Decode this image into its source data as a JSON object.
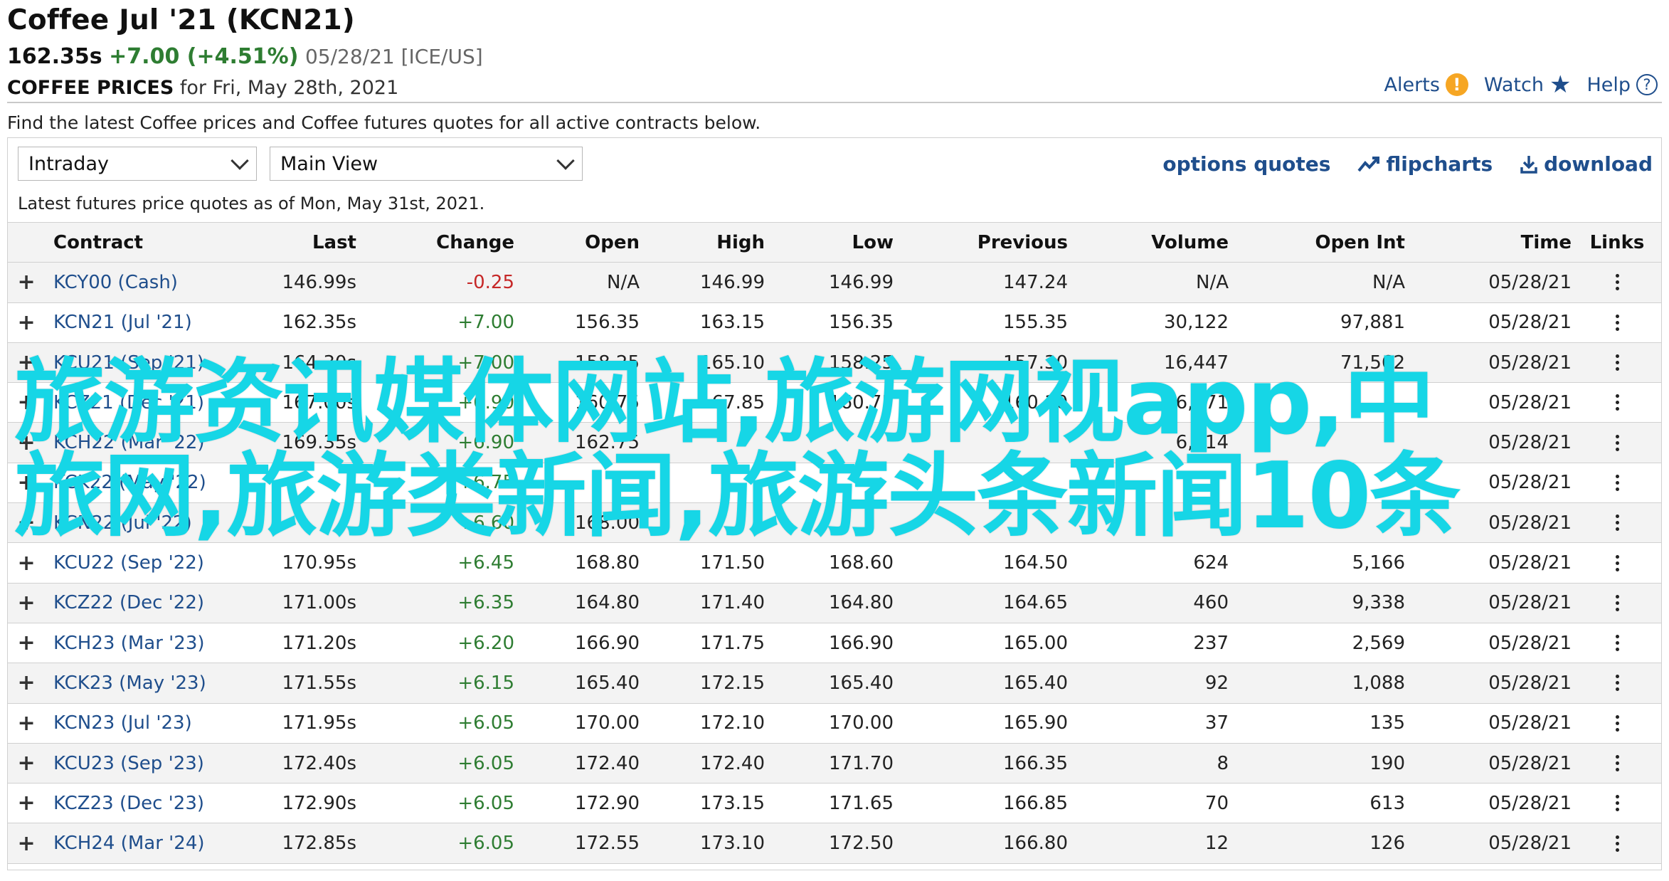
{
  "header": {
    "title": "Coffee Jul '21 (KCN21)",
    "last": "162.35s",
    "change": "+7.00 (+4.51%)",
    "date_exchange": "05/28/21 [ICE/US]",
    "section": "COFFEE PRICES",
    "for_date": "for Fri, May 28th, 2021"
  },
  "top_actions": {
    "alerts": "Alerts",
    "watch": "Watch",
    "help": "Help"
  },
  "description": "Find the latest Coffee prices and Coffee futures quotes for all active contracts below.",
  "controls": {
    "period_select": "Intraday",
    "view_select": "Main View",
    "options_quotes": "options quotes",
    "flipcharts": "flipcharts",
    "download": "download"
  },
  "as_of": "Latest futures price quotes as of Mon, May 31st, 2021.",
  "table": {
    "headers": {
      "contract": "Contract",
      "last": "Last",
      "change": "Change",
      "open": "Open",
      "high": "High",
      "low": "Low",
      "previous": "Previous",
      "volume": "Volume",
      "open_int": "Open Int",
      "time": "Time",
      "links": "Links"
    },
    "rows": [
      {
        "contract": "KCY00 (Cash)",
        "last": "146.99s",
        "change": "-0.25",
        "dir": "neg",
        "open": "N/A",
        "high": "146.99",
        "low": "146.99",
        "previous": "147.24",
        "volume": "N/A",
        "open_int": "N/A",
        "time": "05/28/21"
      },
      {
        "contract": "KCN21 (Jul '21)",
        "last": "162.35s",
        "change": "+7.00",
        "dir": "pos",
        "open": "156.35",
        "high": "163.15",
        "low": "156.35",
        "previous": "155.35",
        "volume": "30,122",
        "open_int": "97,881",
        "time": "05/28/21"
      },
      {
        "contract": "KCU21 (Sep '21)",
        "last": "164.30s",
        "change": "+7.00",
        "dir": "pos",
        "open": "158.25",
        "high": "165.10",
        "low": "158.25",
        "previous": "157.30",
        "volume": "16,447",
        "open_int": "71,562",
        "time": "05/28/21"
      },
      {
        "contract": "KCZ21 (Dec '21)",
        "last": "167.00s",
        "change": "+6.90",
        "dir": "pos",
        "open": "160.75",
        "high": "167.85",
        "low": "160.75",
        "previous": "160.10",
        "volume": "6,371",
        "open_int": "",
        "time": "05/28/21"
      },
      {
        "contract": "KCH22 (Mar '22)",
        "last": "169.35s",
        "change": "+6.90",
        "dir": "pos",
        "open": "162.75",
        "high": "",
        "low": "",
        "previous": "",
        "volume": "6,414",
        "open_int": "",
        "time": "05/28/21"
      },
      {
        "contract": "KCK22 (May '22)",
        "last": "",
        "change": "+6.75",
        "dir": "pos",
        "open": "",
        "high": "",
        "low": "",
        "previous": "",
        "volume": "",
        "open_int": "",
        "time": "05/28/21"
      },
      {
        "contract": "KCN22 (Jul '22)",
        "last": "",
        "change": "+6.60",
        "dir": "pos",
        "open": "168.00",
        "high": "",
        "low": "",
        "previous": "",
        "volume": "",
        "open_int": "",
        "time": "05/28/21"
      },
      {
        "contract": "KCU22 (Sep '22)",
        "last": "170.95s",
        "change": "+6.45",
        "dir": "pos",
        "open": "168.80",
        "high": "171.50",
        "low": "168.60",
        "previous": "164.50",
        "volume": "624",
        "open_int": "5,166",
        "time": "05/28/21"
      },
      {
        "contract": "KCZ22 (Dec '22)",
        "last": "171.00s",
        "change": "+6.35",
        "dir": "pos",
        "open": "164.80",
        "high": "171.40",
        "low": "164.80",
        "previous": "164.65",
        "volume": "460",
        "open_int": "9,338",
        "time": "05/28/21"
      },
      {
        "contract": "KCH23 (Mar '23)",
        "last": "171.20s",
        "change": "+6.20",
        "dir": "pos",
        "open": "166.90",
        "high": "171.75",
        "low": "166.90",
        "previous": "165.00",
        "volume": "237",
        "open_int": "2,569",
        "time": "05/28/21"
      },
      {
        "contract": "KCK23 (May '23)",
        "last": "171.55s",
        "change": "+6.15",
        "dir": "pos",
        "open": "165.40",
        "high": "172.15",
        "low": "165.40",
        "previous": "165.40",
        "volume": "92",
        "open_int": "1,088",
        "time": "05/28/21"
      },
      {
        "contract": "KCN23 (Jul '23)",
        "last": "171.95s",
        "change": "+6.05",
        "dir": "pos",
        "open": "170.00",
        "high": "172.10",
        "low": "170.00",
        "previous": "165.90",
        "volume": "37",
        "open_int": "135",
        "time": "05/28/21"
      },
      {
        "contract": "KCU23 (Sep '23)",
        "last": "172.40s",
        "change": "+6.05",
        "dir": "pos",
        "open": "172.40",
        "high": "172.40",
        "low": "171.70",
        "previous": "166.35",
        "volume": "8",
        "open_int": "190",
        "time": "05/28/21"
      },
      {
        "contract": "KCZ23 (Dec '23)",
        "last": "172.90s",
        "change": "+6.05",
        "dir": "pos",
        "open": "172.90",
        "high": "173.15",
        "low": "171.65",
        "previous": "166.85",
        "volume": "70",
        "open_int": "613",
        "time": "05/28/21"
      },
      {
        "contract": "KCH24 (Mar '24)",
        "last": "172.85s",
        "change": "+6.05",
        "dir": "pos",
        "open": "172.55",
        "high": "173.10",
        "low": "172.50",
        "previous": "166.80",
        "volume": "12",
        "open_int": "126",
        "time": "05/28/21"
      }
    ]
  },
  "overlay_text": "旅游资讯媒体网站,旅游网视app,中旅网,旅游类新闻,旅游头条新闻10条",
  "colors": {
    "link": "#1f4e8c",
    "positive": "#2e7d32",
    "negative": "#c62828",
    "overlay": "#16d6e6",
    "alert": "#f6a623"
  },
  "icons": {
    "alerts": "alert-icon",
    "watch": "star-icon",
    "help": "help-icon",
    "flipcharts": "chart-trend-icon",
    "download": "download-icon",
    "expand": "plus-icon",
    "links": "kebab-menu-icon"
  }
}
